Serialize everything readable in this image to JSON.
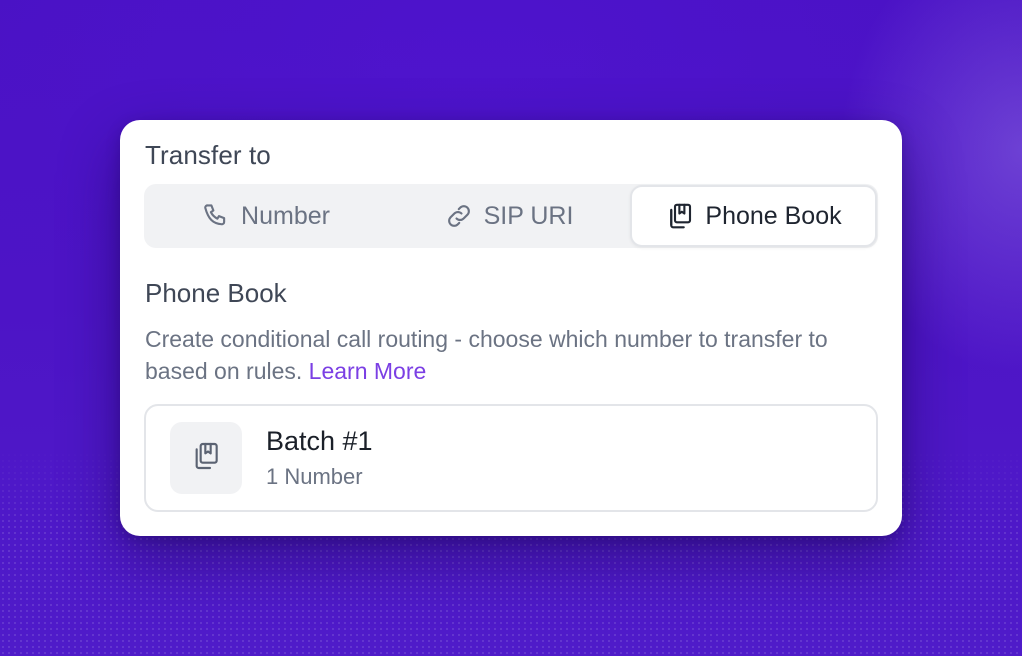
{
  "transfer": {
    "label": "Transfer to",
    "options": [
      {
        "label": "Number",
        "icon": "phone-icon",
        "selected": false
      },
      {
        "label": "SIP URI",
        "icon": "link-icon",
        "selected": false
      },
      {
        "label": "Phone Book",
        "icon": "phone-book-icon",
        "selected": true
      }
    ]
  },
  "phone_book": {
    "title": "Phone Book",
    "description": "Create conditional call routing - choose which number to transfer to based on rules.",
    "learn_more": "Learn More",
    "entries": [
      {
        "name": "Batch #1",
        "count": "1 Number",
        "icon": "phone-book-icon"
      }
    ]
  },
  "colors": {
    "accent": "#7b3fe4",
    "background": "#4a12c4",
    "text_primary": "#1f2530",
    "text_secondary": "#6b7383"
  }
}
